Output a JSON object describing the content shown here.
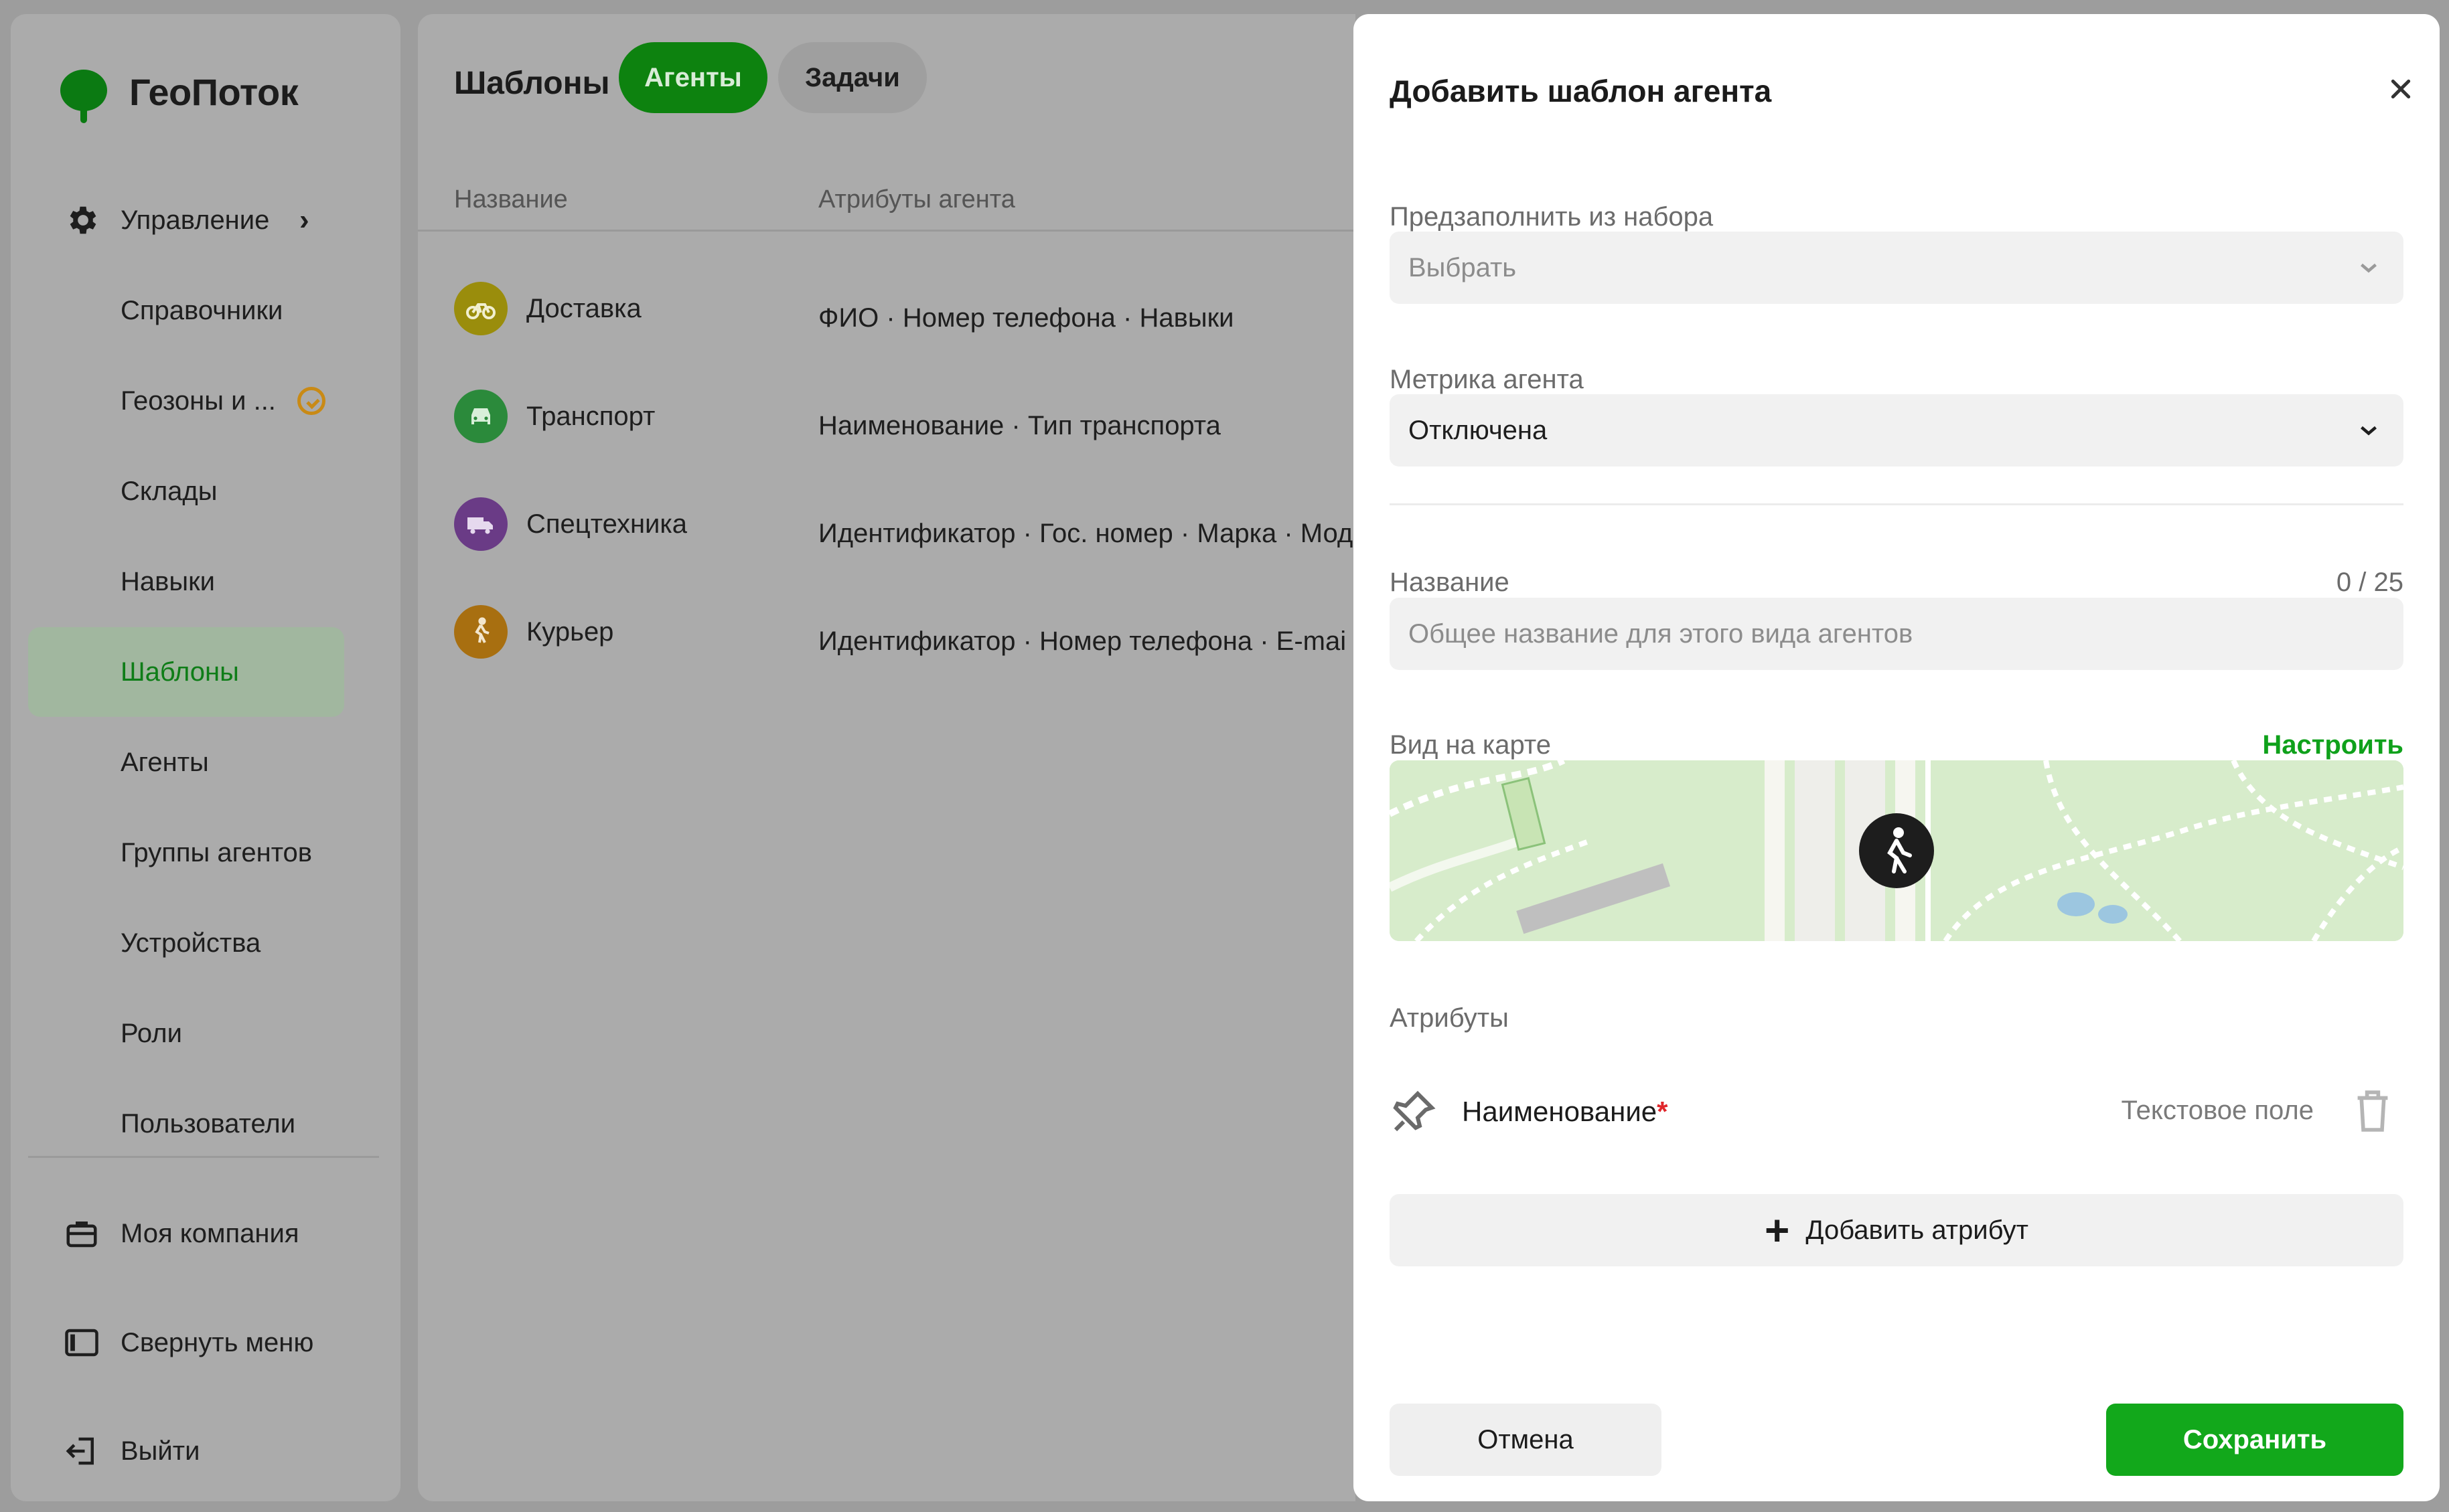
{
  "app": {
    "name": "ГеоПоток"
  },
  "sidebar": {
    "items": [
      {
        "label": "Управление",
        "icon": "gear-icon"
      },
      {
        "label": "Справочники"
      },
      {
        "label": "Геозоны и ...",
        "badge": "check-circle-icon"
      },
      {
        "label": "Склады"
      },
      {
        "label": "Навыки"
      },
      {
        "label": "Шаблоны",
        "active": true
      },
      {
        "label": "Агенты"
      },
      {
        "label": "Группы агентов"
      },
      {
        "label": "Устройства"
      },
      {
        "label": "Роли"
      },
      {
        "label": "Пользователи"
      }
    ],
    "bottom": [
      {
        "label": "Моя компания",
        "icon": "briefcase-icon"
      },
      {
        "label": "Свернуть меню",
        "icon": "sidebar-collapse-icon"
      },
      {
        "label": "Выйти",
        "icon": "logout-icon"
      }
    ]
  },
  "content": {
    "title": "Шаблоны",
    "tabs": [
      {
        "label": "Агенты",
        "active": true
      },
      {
        "label": "Задачи",
        "active": false
      }
    ],
    "columns": [
      "Название",
      "Атрибуты агента"
    ],
    "rows": [
      {
        "name": "Доставка",
        "attrs": "ФИО · Номер телефона · Навыки",
        "icon": "bicycle-icon",
        "color": "#9a8d0c"
      },
      {
        "name": "Транспорт",
        "attrs": "Наименование · Тип транспорта",
        "icon": "car-icon",
        "color": "#2b8a3b"
      },
      {
        "name": "Спецтехника",
        "attrs": "Идентификатор · Гос. номер · Марка · Мод",
        "icon": "truck-icon",
        "color": "#6a3b86"
      },
      {
        "name": "Курьер",
        "attrs": "Идентификатор · Номер телефона · E-mai",
        "icon": "walking-person-icon",
        "color": "#a86f10"
      }
    ]
  },
  "modal": {
    "title": "Добавить шаблон агента",
    "prefill_label": "Предзаполнить из набора",
    "prefill_placeholder": "Выбрать",
    "metric_label": "Метрика агента",
    "metric_value": "Отключена",
    "name_label": "Название",
    "name_counter": "0 / 25",
    "name_placeholder": "Общее название для этого вида агентов",
    "map_label": "Вид на карте",
    "map_action": "Настроить",
    "attributes_label": "Атрибуты",
    "attribute": {
      "name": "Наименование",
      "required_mark": "*",
      "type": "Текстовое поле"
    },
    "add_attribute": "Добавить атрибут",
    "cancel": "Отмена",
    "save": "Сохранить"
  },
  "colors": {
    "brand_green": "#12a81b",
    "active_tab": "#0d820f",
    "required": "#e0262b"
  }
}
